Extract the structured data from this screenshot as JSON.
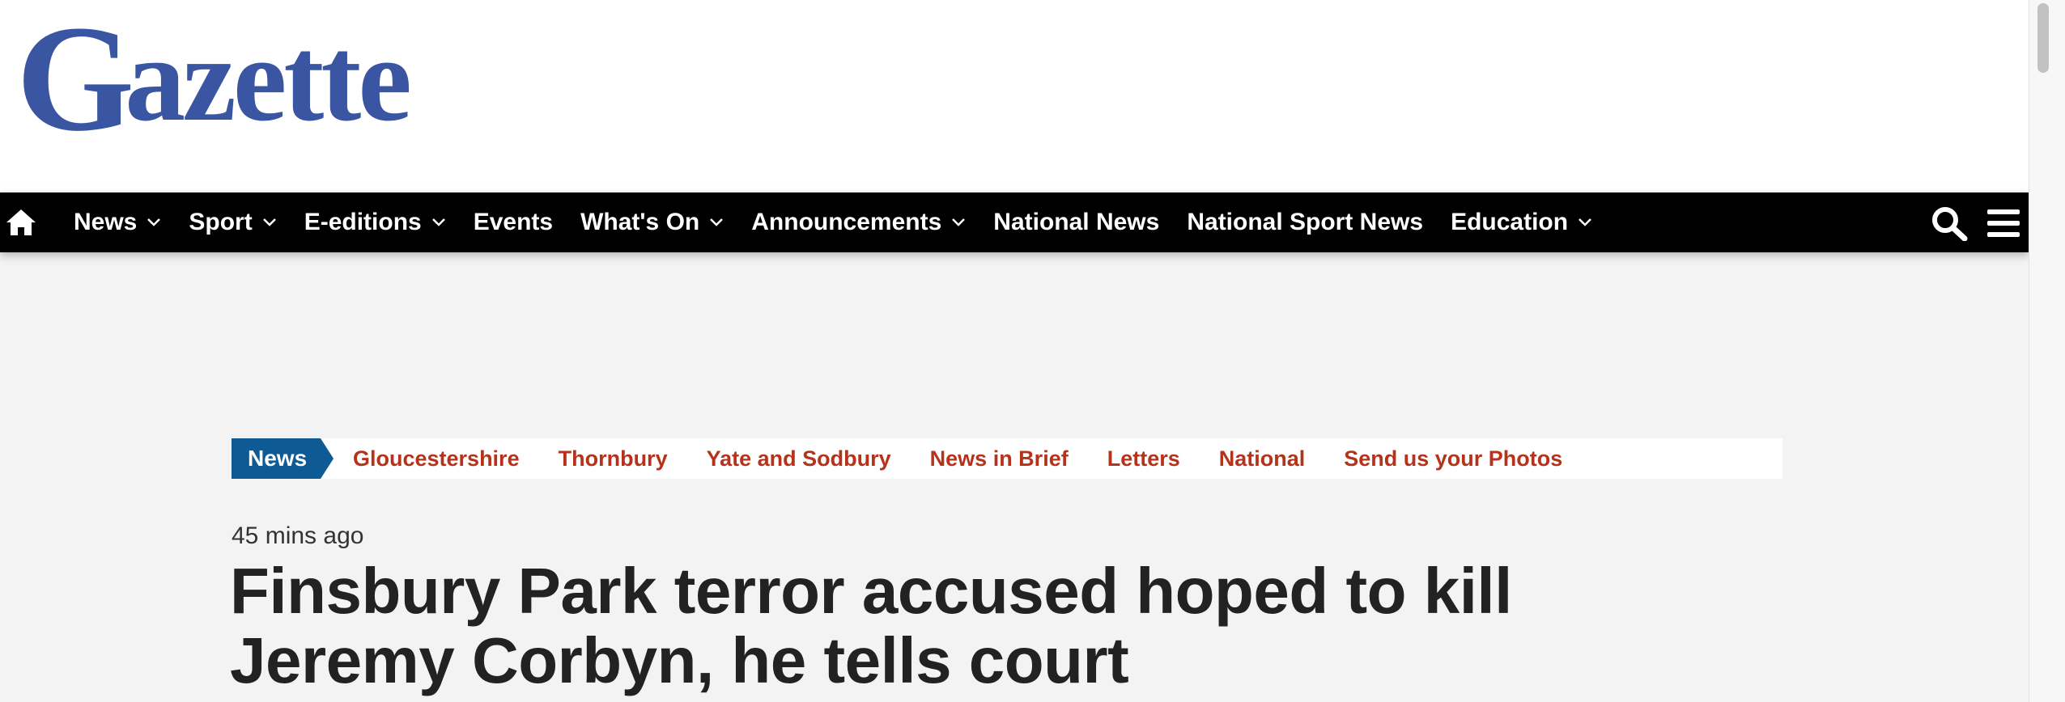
{
  "site": {
    "logo_text": "Gazette",
    "brand_color": "#3a56a3"
  },
  "nav": {
    "home_icon": "home-icon",
    "items": [
      {
        "label": "News",
        "has_dropdown": true
      },
      {
        "label": "Sport",
        "has_dropdown": true
      },
      {
        "label": "E-editions",
        "has_dropdown": true
      },
      {
        "label": "Events",
        "has_dropdown": false
      },
      {
        "label": "What's On",
        "has_dropdown": true
      },
      {
        "label": "Announcements",
        "has_dropdown": true
      },
      {
        "label": "National News",
        "has_dropdown": false
      },
      {
        "label": "National Sport News",
        "has_dropdown": false
      },
      {
        "label": "Education",
        "has_dropdown": true
      }
    ],
    "search_icon": "search-icon",
    "menu_icon": "hamburger-menu-icon"
  },
  "section": {
    "tag": "News",
    "tag_color": "#0e5a94",
    "link_color": "#b5321b",
    "links": [
      "Gloucestershire",
      "Thornbury",
      "Yate and Sodbury",
      "News in Brief",
      "Letters",
      "National",
      "Send us your Photos"
    ]
  },
  "article": {
    "timestamp": "45 mins ago",
    "headline": "Finsbury Park terror accused hoped to kill Jeremy Corbyn, he tells court"
  }
}
